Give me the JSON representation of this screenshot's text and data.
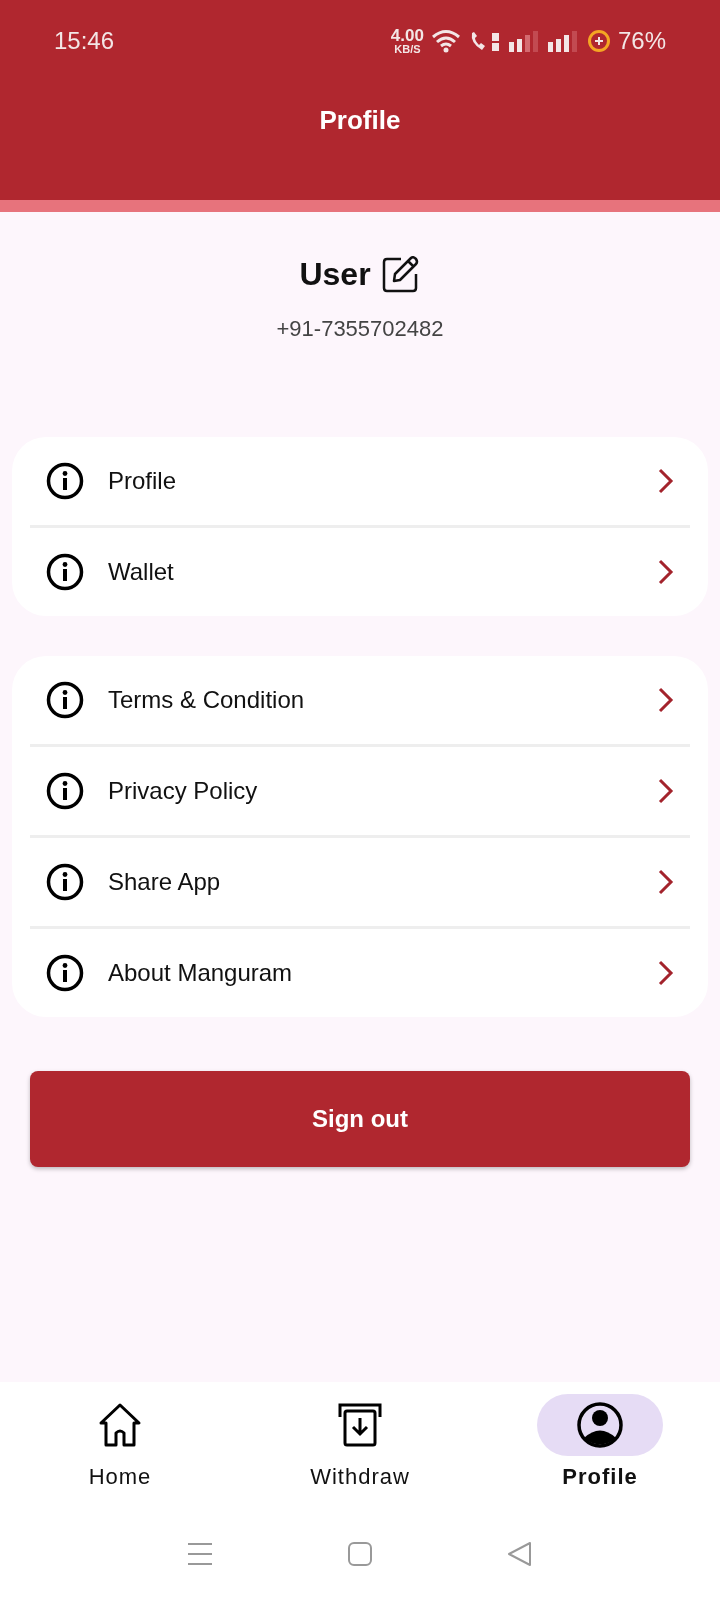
{
  "status_bar": {
    "time": "15:46",
    "net_speed": "4.00",
    "net_unit": "KB/S",
    "battery": "76%"
  },
  "header": {
    "title": "Profile"
  },
  "user": {
    "name": "User",
    "phone": "+91-7355702482"
  },
  "menu_groups": [
    {
      "items": [
        {
          "label": "Profile"
        },
        {
          "label": "Wallet"
        }
      ]
    },
    {
      "items": [
        {
          "label": "Terms & Condition"
        },
        {
          "label": "Privacy Policy"
        },
        {
          "label": "Share App"
        },
        {
          "label": "About Manguram"
        }
      ]
    }
  ],
  "sign_out": {
    "label": "Sign out"
  },
  "bottom_nav": [
    {
      "kind": "home",
      "label": "Home",
      "selected": false
    },
    {
      "kind": "withdraw",
      "label": "Withdraw",
      "selected": false
    },
    {
      "kind": "profile",
      "label": "Profile",
      "selected": true
    }
  ]
}
